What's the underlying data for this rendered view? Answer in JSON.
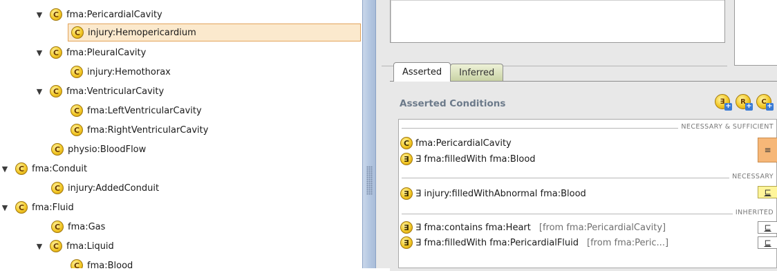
{
  "tree": {
    "rows": [
      {
        "toggle": "▼",
        "label": "fma:PericardialCavity"
      },
      {
        "toggle": "",
        "label": "injury:Hemopericardium"
      },
      {
        "toggle": "▼",
        "label": "fma:PleuralCavity"
      },
      {
        "toggle": "",
        "label": "injury:Hemothorax"
      },
      {
        "toggle": "▼",
        "label": "fma:VentricularCavity"
      },
      {
        "toggle": "",
        "label": "fma:LeftVentricularCavity"
      },
      {
        "toggle": "",
        "label": "fma:RightVentricularCavity"
      },
      {
        "toggle": "",
        "label": "physio:BloodFlow"
      },
      {
        "toggle": "▼",
        "label": "fma:Conduit"
      },
      {
        "toggle": "",
        "label": "injury:AddedConduit"
      },
      {
        "toggle": "▼",
        "label": "fma:Fluid"
      },
      {
        "toggle": "",
        "label": "fma:Gas"
      },
      {
        "toggle": "▼",
        "label": "fma:Liquid"
      },
      {
        "toggle": "",
        "label": "fma:Blood"
      }
    ],
    "class_icon": "C"
  },
  "tabs": {
    "asserted": "Asserted",
    "inferred": "Inferred"
  },
  "conditions": {
    "header": "Asserted Conditions",
    "toolbar_icons": [
      "add-restriction-icon",
      "add-r-icon",
      "add-class-icon",
      "delete-icon"
    ],
    "sections": {
      "necessary_sufficient": "NECESSARY & SUFFICIENT",
      "necessary": "NECESSARY",
      "inherited": "INHERITED"
    },
    "rows": {
      "ns_class": "fma:PericardialCavity",
      "ns_restriction": "∃ fma:filledWith fma:Blood",
      "nec_restriction": "∃ injury:filledWithAbnormal fma:Blood",
      "inh1_restriction": "∃ fma:contains fma:Heart",
      "inh1_from": "[from fma:PericardialCavity]",
      "inh2_restriction": "∃ fma:filledWith fma:PericardialFluid",
      "inh2_from": "[from fma:Peric...]"
    },
    "badges": {
      "equivalent": "≡",
      "subclass": "⊑",
      "inh1": "⊑",
      "inh2": "⊑"
    },
    "icons": {
      "class_icon": "C",
      "exists_icon": "∃"
    }
  },
  "colors": {
    "selection_bg": "#fbe9cd",
    "selection_border": "#e3a35a",
    "equiv_badge": "#f6b778",
    "subclass_badge": "#fff59a",
    "splitter": "#b5c8e2"
  }
}
